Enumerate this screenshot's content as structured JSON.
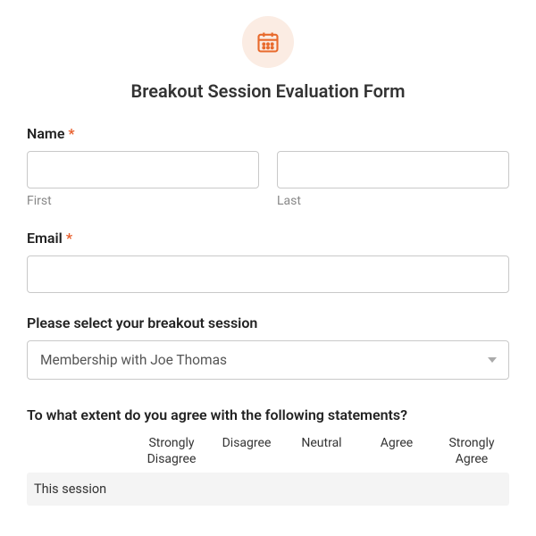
{
  "title": "Breakout Session Evaluation Form",
  "fields": {
    "name": {
      "label": "Name",
      "required": "*",
      "first_sub": "First",
      "last_sub": "Last"
    },
    "email": {
      "label": "Email",
      "required": "*"
    },
    "session": {
      "label": "Please select your breakout session",
      "selected": "Membership with Joe Thomas"
    },
    "matrix": {
      "label": "To what extent do you agree with the following statements?",
      "headers": [
        "Strongly Disagree",
        "Disagree",
        "Neutral",
        "Agree",
        "Strongly Agree"
      ],
      "rows": [
        "This session"
      ]
    }
  }
}
